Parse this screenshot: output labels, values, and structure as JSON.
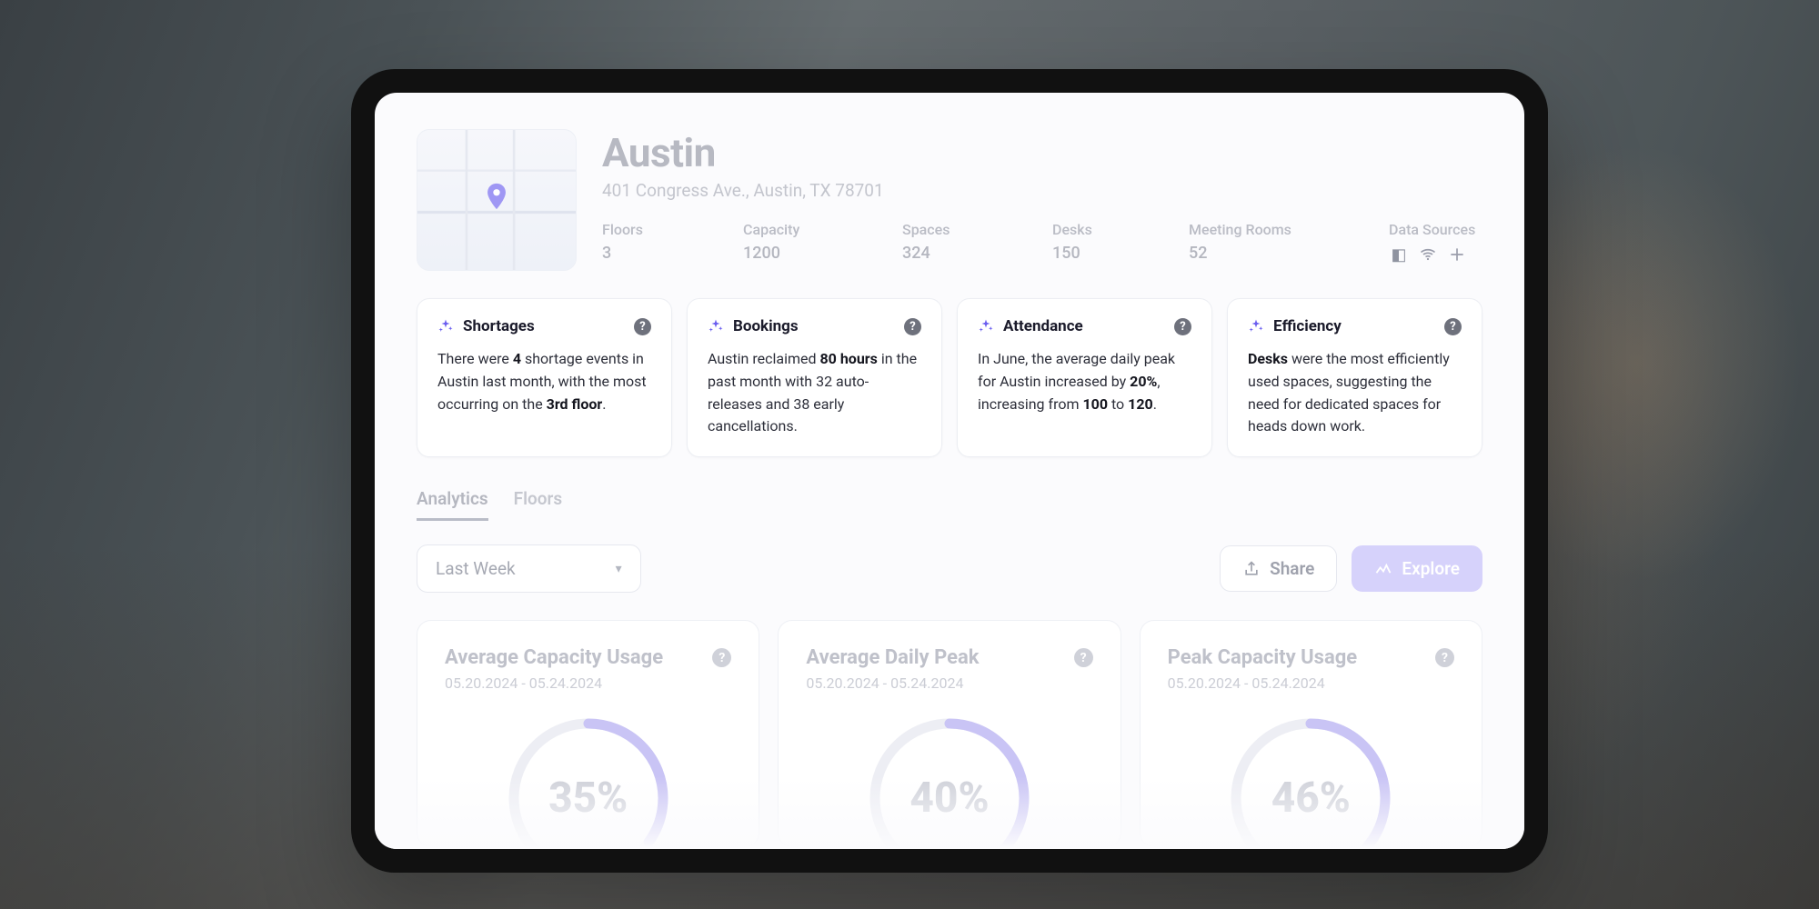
{
  "location": {
    "name": "Austin",
    "address": "401 Congress Ave., Austin, TX 78701"
  },
  "stats": [
    {
      "label": "Floors",
      "value": "3"
    },
    {
      "label": "Capacity",
      "value": "1200"
    },
    {
      "label": "Spaces",
      "value": "324"
    },
    {
      "label": "Desks",
      "value": "150"
    },
    {
      "label": "Meeting Rooms",
      "value": "52"
    }
  ],
  "data_sources_label": "Data Sources",
  "insight_cards": {
    "shortages": {
      "title": "Shortages",
      "pre1": "There were ",
      "b1": "4",
      "mid1": " shortage events in Austin last month, with the most occurring on the ",
      "b2": "3rd floor",
      "post": "."
    },
    "bookings": {
      "title": "Bookings",
      "pre1": "Austin reclaimed ",
      "b1": "80 hours",
      "post": " in the past month with 32 auto-releases and 38 early cancellations."
    },
    "attendance": {
      "title": "Attendance",
      "pre1": "In June, the average daily peak for Austin increased by ",
      "b1": "20%",
      "mid1": ", increasing from ",
      "b2": "100",
      "mid2": " to ",
      "b3": "120",
      "post": "."
    },
    "efficiency": {
      "title": "Efficiency",
      "b1": "Desks",
      "post": " were the most efficiently used spaces, suggesting the need for dedicated spaces for heads down work."
    }
  },
  "tabs": {
    "analytics": "Analytics",
    "floors": "Floors"
  },
  "toolbar": {
    "range_label": "Last Week",
    "share_label": "Share",
    "explore_label": "Explore"
  },
  "gauges": [
    {
      "title": "Average Capacity Usage",
      "range": "05.20.2024 - 05.24.2024",
      "pct": 35,
      "label": "35%"
    },
    {
      "title": "Average Daily Peak",
      "range": "05.20.2024 - 05.24.2024",
      "pct": 40,
      "label": "40%"
    },
    {
      "title": "Peak Capacity Usage",
      "range": "05.20.2024 - 05.24.2024",
      "pct": 46,
      "label": "46%"
    }
  ],
  "colors": {
    "accent": "#6b5ef0",
    "accent_soft": "#d6d2fb"
  }
}
